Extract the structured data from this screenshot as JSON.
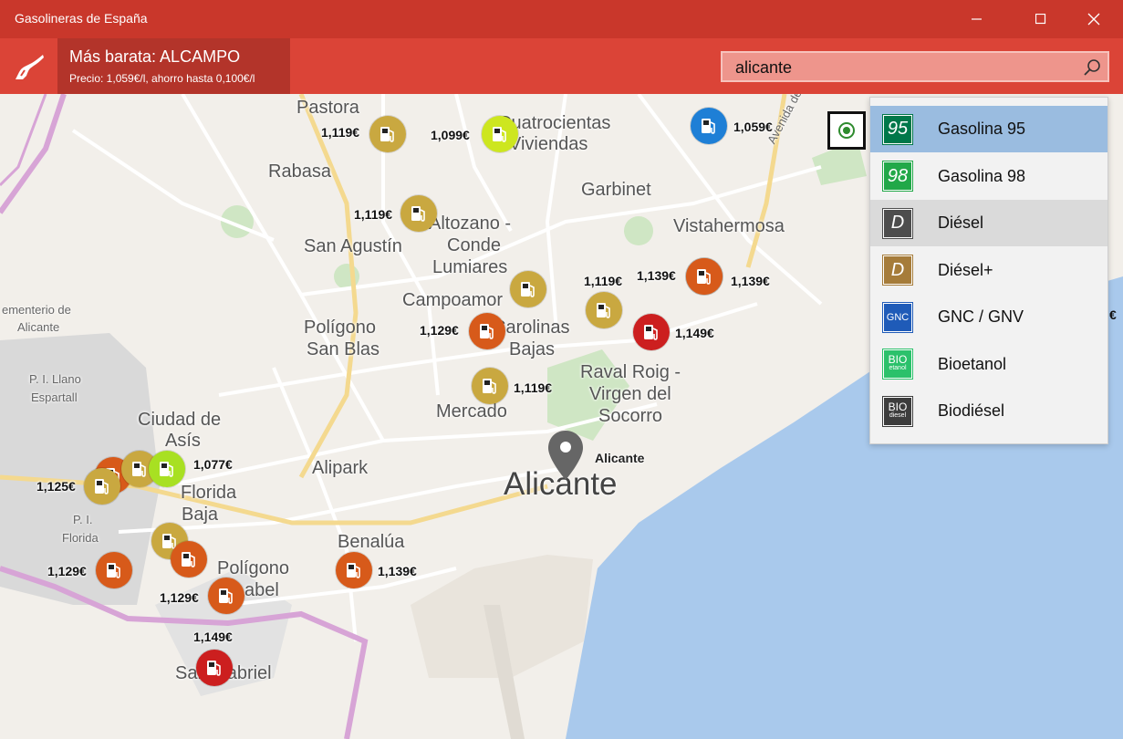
{
  "window": {
    "title": "Gasolineras de España",
    "minimize_glyph": "—",
    "maximize_glyph": "☐",
    "close_glyph": "✕"
  },
  "header": {
    "cheapest_title": "Más barata: ALCAMPO",
    "cheapest_subtitle": "Precio: 1,059€/l, ahorro hasta 0,100€/l",
    "logo_icon": "fuel-nozzle-icon"
  },
  "search": {
    "value": "alicante",
    "icon": "search-icon"
  },
  "map": {
    "places": {
      "pastora": "Pastora",
      "cuatrocientas_1": "Cuatrocientas",
      "cuatrocientas_2": "Viviendas",
      "rabasa": "Rabasa",
      "garbinet": "Garbinet",
      "avenida": "Avenida de Den",
      "vistahermosa": "Vistahermosa",
      "altozano_1": "Altozano -",
      "altozano_2": "Conde",
      "altozano_3": "Lumiares",
      "san_agustin": "San Agustín",
      "cementerio_1": "ementerio de",
      "cementerio_2": "Alicante",
      "campoamor": "Campoamor",
      "carolinas_1": "Carolinas",
      "carolinas_2": "Bajas",
      "poligono_sb_1": "Polígono",
      "poligono_sb_2": "San Blas",
      "raval_1": "Raval Roig -",
      "raval_2": "Virgen del",
      "raval_3": "Socorro",
      "pi_llano_1": "P. I. Llano",
      "pi_llano_2": "Espartall",
      "mercado": "Mercado",
      "ciudad_asis_1": "Ciudad de",
      "ciudad_asis_2": "Asís",
      "alipark": "Alipark",
      "alicante_pin": "Alicante",
      "alicante_big": "Alicante",
      "florida_1": "Florida",
      "florida_2": "Baja",
      "pi_florida_1": "P. I.",
      "pi_florida_2": "Florida",
      "benalua": "Benalúa",
      "poligono_b_1": "Polígono",
      "poligono_b_2": "abel",
      "san_gabriel": "San Gabriel"
    },
    "stations": [
      {
        "price": "1,119€",
        "color": "#c9a840"
      },
      {
        "price": "1,099€",
        "color": "#cde61f"
      },
      {
        "price": "1,059€",
        "color": "#1e7fd6"
      },
      {
        "price": "1,119€",
        "color": "#c9a840"
      },
      {
        "price": "1,119€",
        "color": "#c9a840"
      },
      {
        "price": "1,139€",
        "color": "#d75a1a"
      },
      {
        "price": "1,139€",
        "color": "#d75a1a"
      },
      {
        "price": "1,119€",
        "color": "#c9a840"
      },
      {
        "price": "1,129€",
        "color": "#d75a1a"
      },
      {
        "price": "1,149€",
        "color": "#cc1f1f"
      },
      {
        "price": "1,119€",
        "color": "#c9a840"
      },
      {
        "price": "1,077€",
        "color": "#a8e022"
      },
      {
        "price": "1,125€",
        "color": "#c9a840"
      },
      {
        "price": "1,129€",
        "color": "#d75a1a"
      },
      {
        "price": "1,129€",
        "color": "#d75a1a"
      },
      {
        "price": "1,139€",
        "color": "#d75a1a"
      },
      {
        "price": "1,149€",
        "color": "#cc1f1f"
      }
    ],
    "edge_price": "€"
  },
  "fuel_menu": {
    "items": [
      {
        "label": "Gasolina 95",
        "icon_text": "95",
        "icon_color": "#00784a",
        "selected": true
      },
      {
        "label": "Gasolina 98",
        "icon_text": "98",
        "icon_color": "#21a848"
      },
      {
        "label": "Diésel",
        "icon_text": "D",
        "icon_color": "#4d4d4d"
      },
      {
        "label": "Diésel+",
        "icon_text": "D",
        "icon_color": "#a67c3a"
      },
      {
        "label": "GNC / GNV",
        "icon_text": "GNC",
        "icon_color": "#1f5bb8"
      },
      {
        "label": "Bioetanol",
        "icon_text": "BIO",
        "icon_sub": "etanol",
        "icon_color": "#2bc16b"
      },
      {
        "label": "Biodiésel",
        "icon_text": "BIO",
        "icon_sub": "diesel",
        "icon_color": "#3d3d3d"
      }
    ]
  }
}
